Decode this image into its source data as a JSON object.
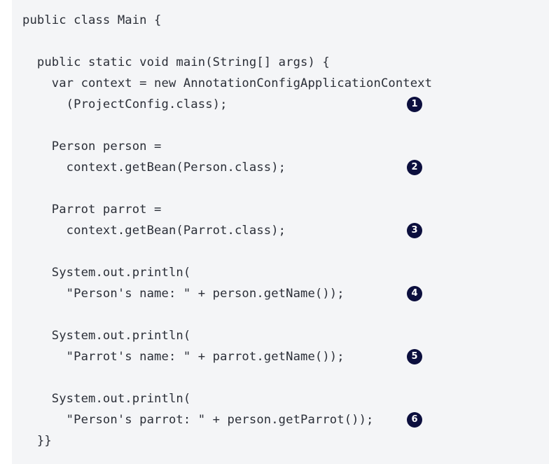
{
  "code": {
    "lines": [
      "public class Main {",
      "",
      "  public static void main(String[] args) {",
      "    var context = new AnnotationConfigApplicationContext",
      "      (ProjectConfig.class);",
      "",
      "    Person person =",
      "      context.getBean(Person.class);",
      "",
      "    Parrot parrot =",
      "      context.getBean(Parrot.class);",
      "",
      "    System.out.println(",
      "      \"Person's name: \" + person.getName());",
      "",
      "    System.out.println(",
      "      \"Parrot's name: \" + parrot.getName());",
      "",
      "    System.out.println(",
      "      \"Person's parrot: \" + person.getParrot());",
      "  }}"
    ],
    "callouts": [
      "1",
      "2",
      "3",
      "4",
      "5",
      "6"
    ]
  },
  "colors": {
    "background": "#f4f5f7",
    "text": "#2b2f38",
    "callout_bg": "#0c0f3e",
    "callout_fg": "#ffffff"
  }
}
